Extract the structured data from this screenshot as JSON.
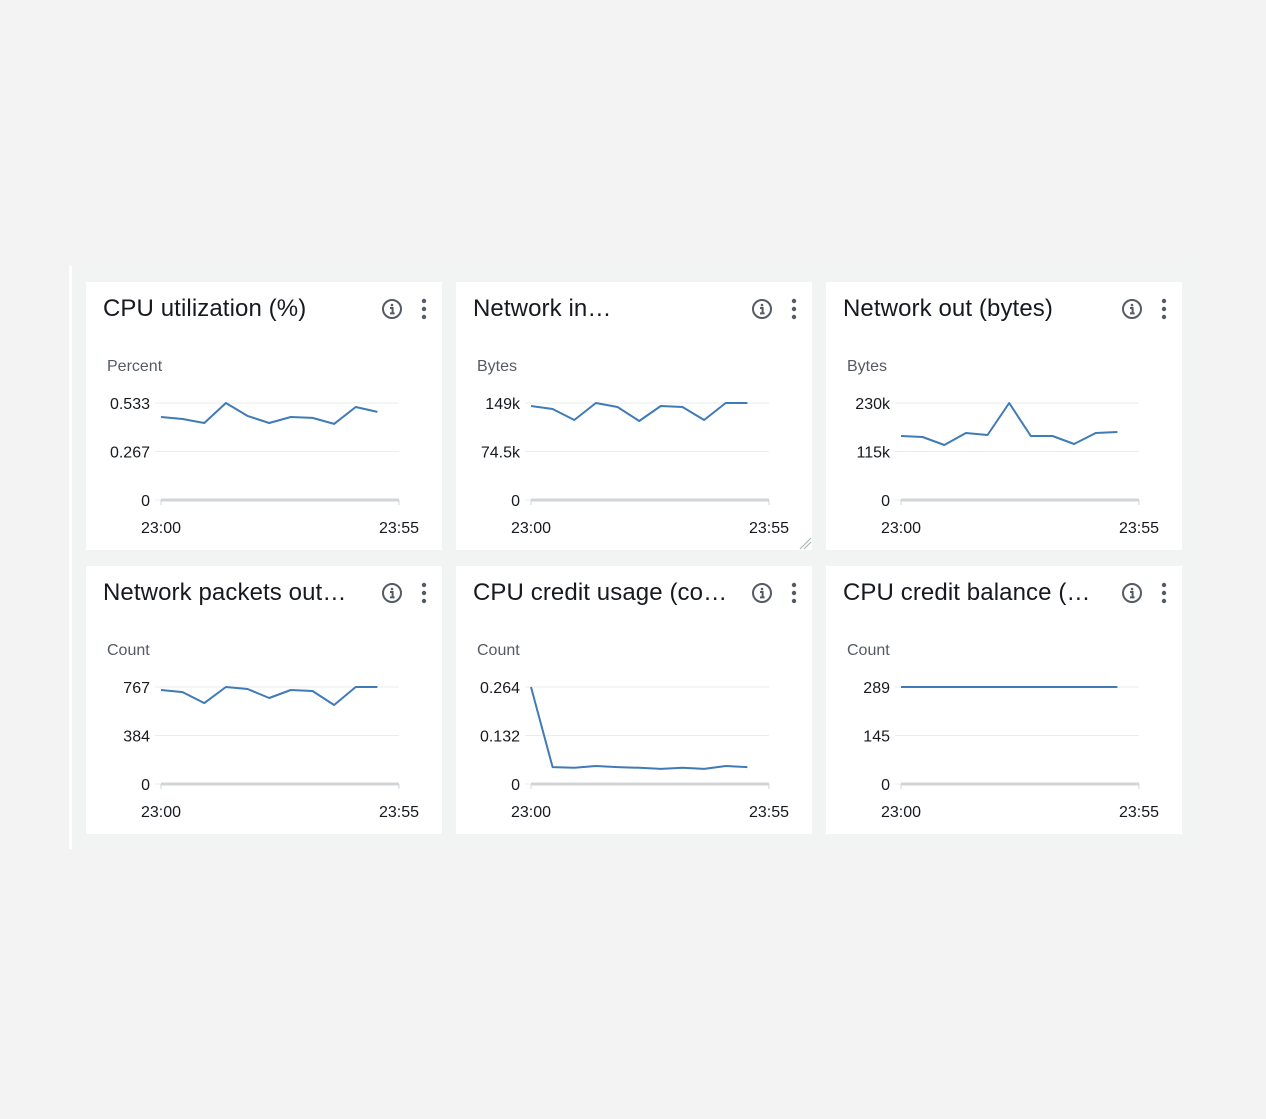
{
  "colors": {
    "line": "#3f7bb6",
    "grid": "#eaeded",
    "axis": "#d1d5d8",
    "text": "#16191f",
    "subtext": "#545b64",
    "icon": "#545b64"
  },
  "widgets": [
    {
      "title": "CPU utilization (%)",
      "icons": {
        "info": "info-circle-icon",
        "menu": "vertical-ellipsis-icon"
      },
      "chart_data": {
        "type": "line",
        "title": "CPU utilization (%)",
        "ylabel": "Percent",
        "xlabel": "",
        "x": [
          "23:00",
          "23:05",
          "23:10",
          "23:15",
          "23:20",
          "23:25",
          "23:30",
          "23:35",
          "23:40",
          "23:45",
          "23:50"
        ],
        "x_range": [
          "23:00",
          "23:55"
        ],
        "x_ticks": [
          "23:00",
          "23:55"
        ],
        "y_ticks": [
          "0",
          "0.267",
          "0.533"
        ],
        "ylim": [
          0,
          0.533
        ],
        "grid": true,
        "series": [
          {
            "name": "CPU utilization",
            "values": [
              0.456,
              0.445,
              0.423,
              0.533,
              0.462,
              0.423,
              0.456,
              0.451,
              0.418,
              0.511,
              0.484
            ]
          }
        ]
      }
    },
    {
      "title": "Network in…",
      "icons": {
        "info": "info-circle-icon",
        "menu": "vertical-ellipsis-icon"
      },
      "chart_data": {
        "type": "line",
        "title": "Network in…",
        "ylabel": "Bytes",
        "xlabel": "",
        "x": [
          "23:00",
          "23:05",
          "23:10",
          "23:15",
          "23:20",
          "23:25",
          "23:30",
          "23:35",
          "23:40",
          "23:45",
          "23:50"
        ],
        "x_range": [
          "23:00",
          "23:55"
        ],
        "x_ticks": [
          "23:00",
          "23:55"
        ],
        "y_ticks": [
          "0",
          "74.5k",
          "149k"
        ],
        "ylim": [
          0,
          149000
        ],
        "grid": true,
        "series": [
          {
            "name": "Network in",
            "values": [
              144400,
              139800,
              122900,
              149000,
              142900,
              121300,
              144400,
              142900,
              122900,
              149000,
              149000
            ]
          }
        ]
      }
    },
    {
      "title": "Network out (bytes)",
      "icons": {
        "info": "info-circle-icon",
        "menu": "vertical-ellipsis-icon"
      },
      "chart_data": {
        "type": "line",
        "title": "Network out (bytes)",
        "ylabel": "Bytes",
        "xlabel": "",
        "x": [
          "23:00",
          "23:05",
          "23:10",
          "23:15",
          "23:20",
          "23:25",
          "23:30",
          "23:35",
          "23:40",
          "23:45",
          "23:50"
        ],
        "x_range": [
          "23:00",
          "23:55"
        ],
        "x_ticks": [
          "23:00",
          "23:55"
        ],
        "y_ticks": [
          "0",
          "115k",
          "230k"
        ],
        "ylim": [
          0,
          230000
        ],
        "grid": true,
        "series": [
          {
            "name": "Network out",
            "values": [
              151800,
              149400,
              130400,
              158900,
              154100,
              230000,
              151800,
              151800,
              132800,
              158900,
              161200
            ]
          }
        ]
      }
    },
    {
      "title": "Network packets out…",
      "icons": {
        "info": "info-circle-icon",
        "menu": "vertical-ellipsis-icon"
      },
      "chart_data": {
        "type": "line",
        "title": "Network packets out…",
        "ylabel": "Count",
        "xlabel": "",
        "x": [
          "23:00",
          "23:05",
          "23:10",
          "23:15",
          "23:20",
          "23:25",
          "23:30",
          "23:35",
          "23:40",
          "23:45",
          "23:50"
        ],
        "x_range": [
          "23:00",
          "23:55"
        ],
        "x_ticks": [
          "23:00",
          "23:55"
        ],
        "y_ticks": [
          "0",
          "384",
          "767"
        ],
        "ylim": [
          0,
          767
        ],
        "grid": true,
        "series": [
          {
            "name": "Network packets out",
            "values": [
              743,
              727,
              640,
              767,
              751,
              680,
              743,
              735,
              625,
              767,
              767
            ]
          }
        ]
      }
    },
    {
      "title": "CPU credit usage (co…",
      "icons": {
        "info": "info-circle-icon",
        "menu": "vertical-ellipsis-icon"
      },
      "chart_data": {
        "type": "line",
        "title": "CPU credit usage (co…",
        "ylabel": "Count",
        "xlabel": "",
        "x": [
          "23:00",
          "23:05",
          "23:10",
          "23:15",
          "23:20",
          "23:25",
          "23:30",
          "23:35",
          "23:40",
          "23:45",
          "23:50"
        ],
        "x_range": [
          "23:00",
          "23:55"
        ],
        "x_ticks": [
          "23:00",
          "23:55"
        ],
        "y_ticks": [
          "0",
          "0.132",
          "0.264"
        ],
        "ylim": [
          0,
          0.264
        ],
        "grid": true,
        "series": [
          {
            "name": "CPU credit usage",
            "values": [
              0.264,
              0.046,
              0.044,
              0.049,
              0.046,
              0.044,
              0.041,
              0.044,
              0.041,
              0.049,
              0.046
            ]
          }
        ]
      }
    },
    {
      "title": "CPU credit balance (…",
      "icons": {
        "info": "info-circle-icon",
        "menu": "vertical-ellipsis-icon"
      },
      "chart_data": {
        "type": "line",
        "title": "CPU credit balance (…",
        "ylabel": "Count",
        "xlabel": "",
        "x": [
          "23:00",
          "23:05",
          "23:10",
          "23:15",
          "23:20",
          "23:25",
          "23:30",
          "23:35",
          "23:40",
          "23:45",
          "23:50"
        ],
        "x_range": [
          "23:00",
          "23:55"
        ],
        "x_ticks": [
          "23:00",
          "23:55"
        ],
        "y_ticks": [
          "0",
          "145",
          "289"
        ],
        "ylim": [
          0,
          289
        ],
        "grid": true,
        "series": [
          {
            "name": "CPU credit balance",
            "values": [
              289,
              289,
              289,
              289,
              289,
              289,
              289,
              289,
              289,
              289,
              289
            ]
          }
        ]
      }
    }
  ],
  "chart_data": [
    {
      "ref": "widgets.0.chart_data"
    },
    {
      "ref": "widgets.1.chart_data"
    },
    {
      "ref": "widgets.2.chart_data"
    },
    {
      "ref": "widgets.3.chart_data"
    },
    {
      "ref": "widgets.4.chart_data"
    },
    {
      "ref": "widgets.5.chart_data"
    }
  ]
}
